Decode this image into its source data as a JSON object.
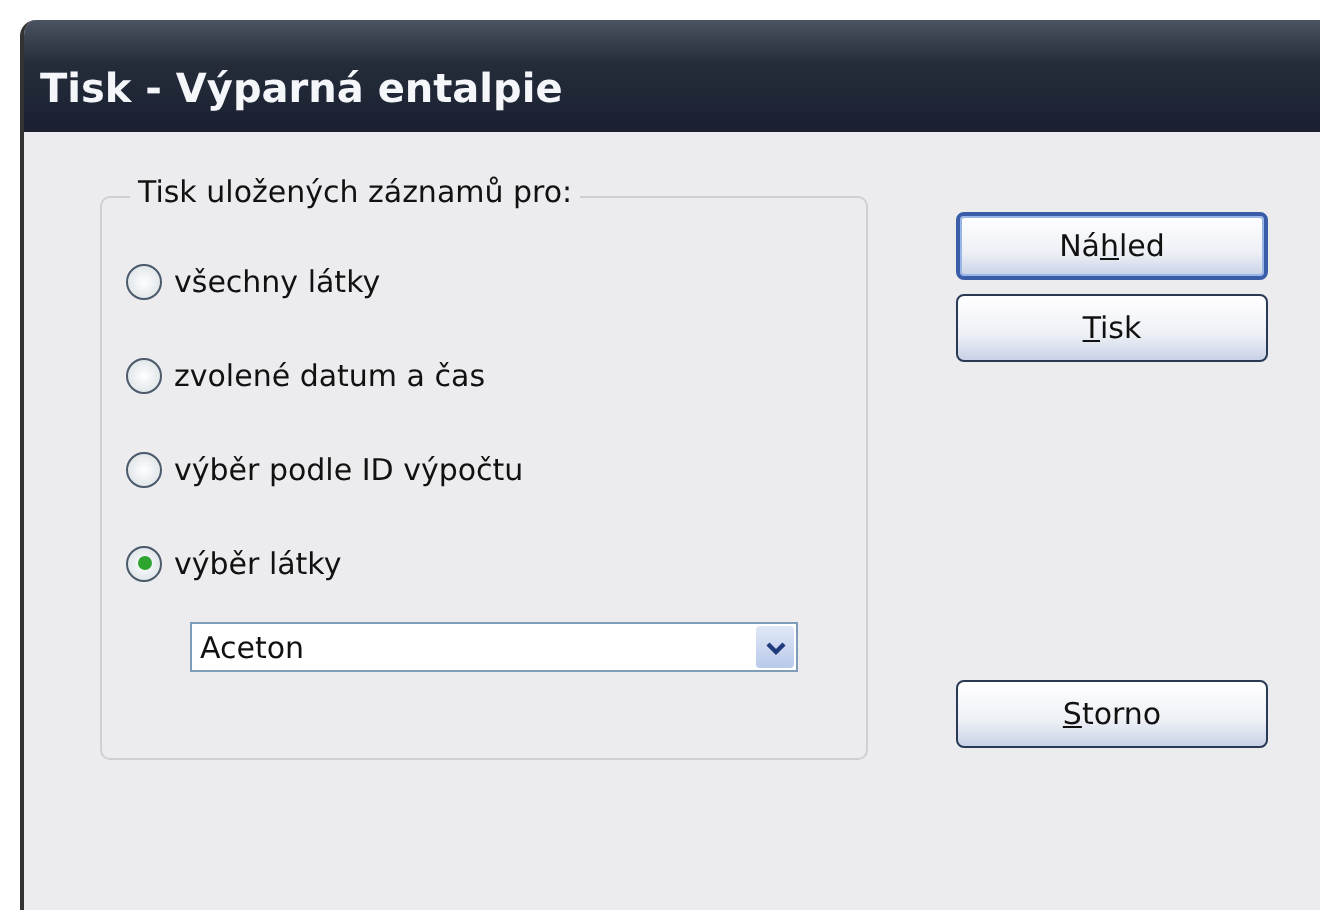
{
  "window": {
    "title": "Tisk - Výparná entalpie"
  },
  "group": {
    "title": "Tisk uložených záznamů pro:",
    "options": [
      {
        "label": "všechny látky",
        "selected": false
      },
      {
        "label": "zvolené datum a čas",
        "selected": false
      },
      {
        "label": "výběr podle ID výpočtu",
        "selected": false
      },
      {
        "label": "výběr látky",
        "selected": true
      }
    ],
    "dropdown": {
      "value": "Aceton"
    }
  },
  "buttons": [
    {
      "label_before": "Ná",
      "mnemonic": "h",
      "label_after": "led",
      "default": true
    },
    {
      "mnemonic": "T",
      "label_after": "isk",
      "default": false
    },
    {
      "mnemonic": "S",
      "label_after": "torno",
      "default": false
    }
  ]
}
